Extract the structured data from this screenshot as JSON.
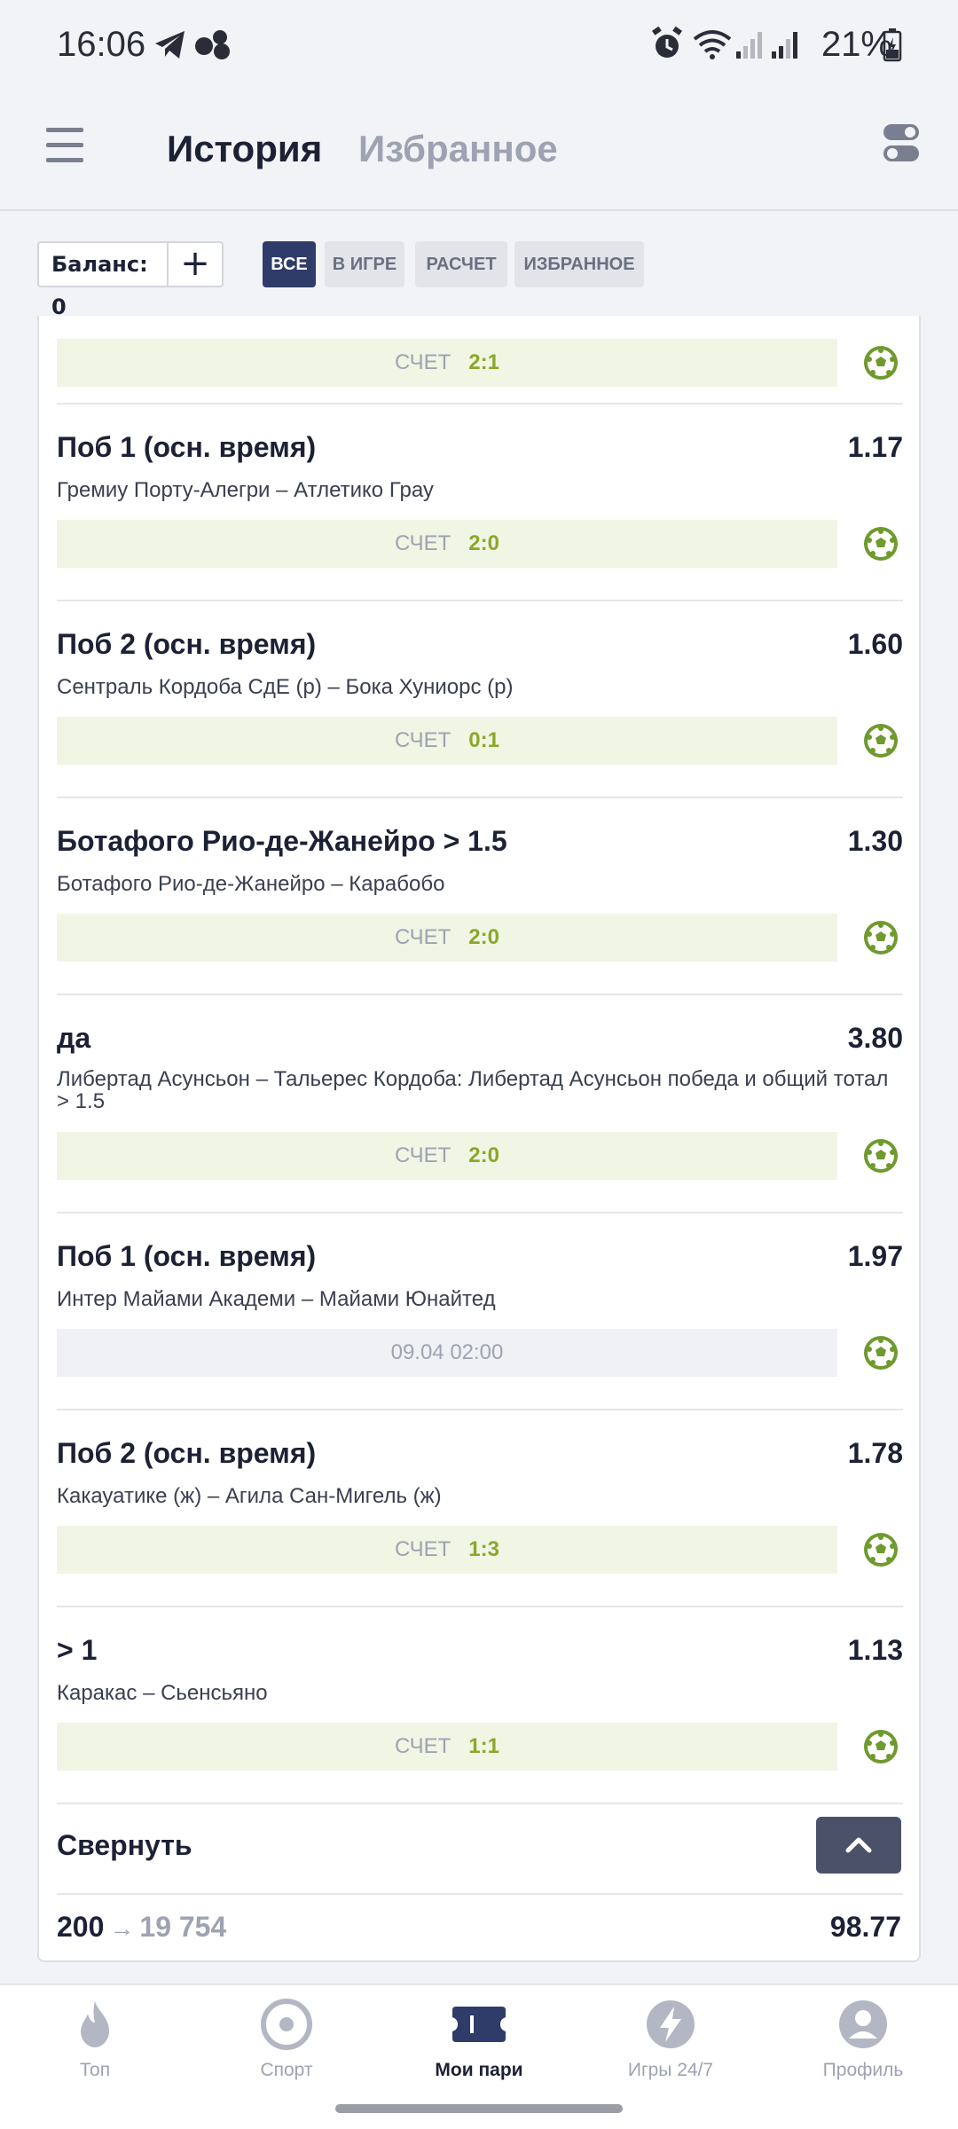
{
  "status_bar": {
    "time": "16:06",
    "battery": "21%"
  },
  "header": {
    "tab_active": "История",
    "tab_inactive": "Избранное"
  },
  "filters": {
    "balance_label": "Баланс: 0",
    "add_symbol": "+",
    "chips": [
      "ВСЕ",
      "В ИГРЕ",
      "РАСЧЕТ",
      "ИЗБРАННОЕ"
    ]
  },
  "bets": [
    {
      "title": "",
      "odds": "",
      "match": "",
      "score_label": "СЧЕТ",
      "score": "2:1"
    },
    {
      "title": "Поб 1 (осн. время)",
      "odds": "1.17",
      "match": "Гремиу Порту-Алегри – Атлетико Грау",
      "score_label": "СЧЕТ",
      "score": "2:0"
    },
    {
      "title": "Поб 2 (осн. время)",
      "odds": "1.60",
      "match": "Сентраль Кордоба СдЕ (р) – Бока Хуниорс (р)",
      "score_label": "СЧЕТ",
      "score": "0:1"
    },
    {
      "title": "Ботафого Рио-де-Жанейро > 1.5",
      "odds": "1.30",
      "match": "Ботафого Рио-де-Жанейро – Карабобо",
      "score_label": "СЧЕТ",
      "score": "2:0"
    },
    {
      "title": "да",
      "odds": "3.80",
      "match": "Либертад Асунсьон – Тальерес Кордоба: Либертад Асунсьон победа и общий тотал > 1.5",
      "score_label": "СЧЕТ",
      "score": "2:0"
    },
    {
      "title": "Поб 1 (осн. время)",
      "odds": "1.97",
      "match": "Интер Майами Академи – Майами Юнайтед",
      "pending": "09.04 02:00"
    },
    {
      "title": "Поб 2 (осн. время)",
      "odds": "1.78",
      "match": "Какауатике (ж) – Агила Сан-Мигель (ж)",
      "score_label": "СЧЕТ",
      "score": "1:3"
    },
    {
      "title": "> 1",
      "odds": "1.13",
      "match": "Каракас – Сьенсьяно",
      "score_label": "СЧЕТ",
      "score": "1:1"
    }
  ],
  "collapse": {
    "label": "Свернуть"
  },
  "summary": {
    "stake": "200",
    "arrow": "→",
    "potential_win": "19 754",
    "total_odds": "98.77"
  },
  "bottom_nav": [
    {
      "label": "Топ",
      "icon": "fire-icon"
    },
    {
      "label": "Спорт",
      "icon": "target-icon"
    },
    {
      "label": "Мои пари",
      "icon": "ticket-icon"
    },
    {
      "label": "Игры 24/7",
      "icon": "lightning-icon"
    },
    {
      "label": "Профиль",
      "icon": "profile-icon"
    }
  ],
  "colors": {
    "accent": "#2f3c6a",
    "score_green": "#8aa82a",
    "ball_green": "#6e9a2e"
  }
}
